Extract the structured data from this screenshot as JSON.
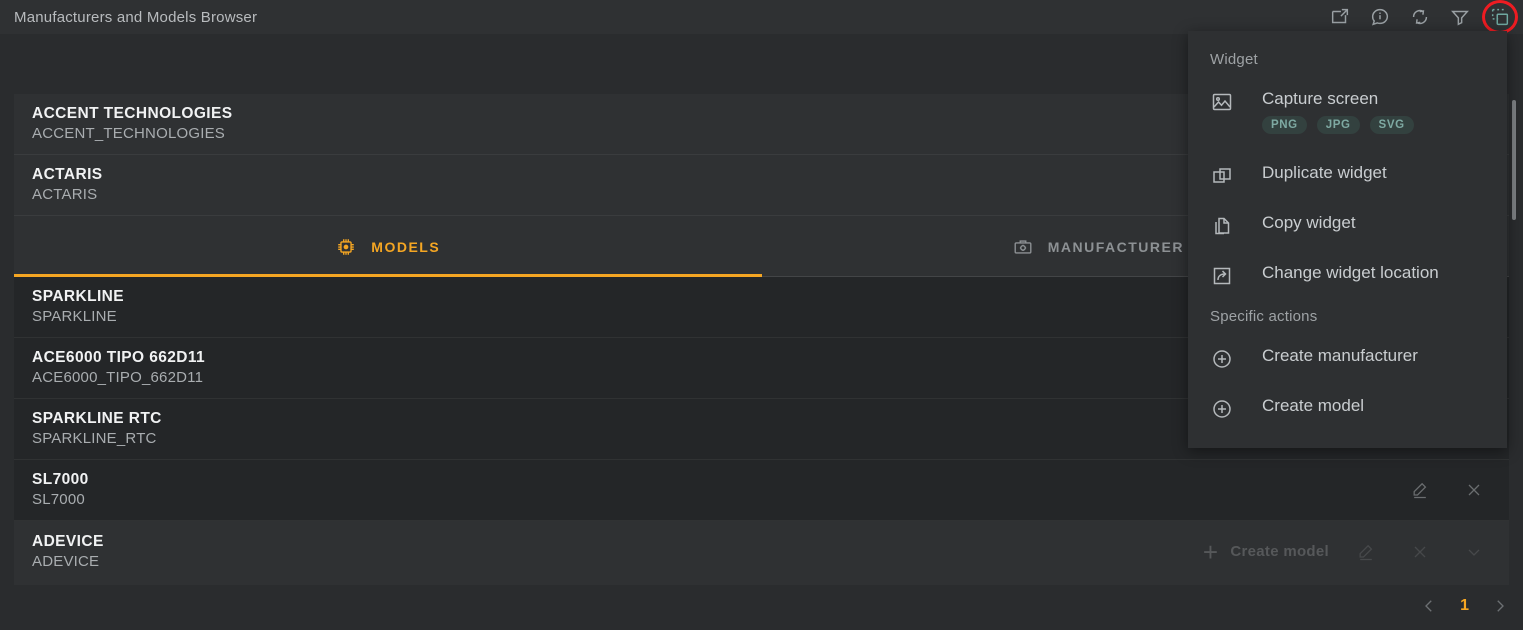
{
  "header": {
    "title": "Manufacturers and Models Browser",
    "icons": [
      {
        "name": "export-widget-icon",
        "label": "Export widget"
      },
      {
        "name": "info-icon",
        "label": "Information"
      },
      {
        "name": "refresh-icon",
        "label": "Refresh"
      },
      {
        "name": "filter-icon",
        "label": "Filter"
      },
      {
        "name": "widget-actions-icon",
        "label": "Widget actions"
      }
    ]
  },
  "list": {
    "manufacturers": [
      {
        "title": "ACCENT TECHNOLOGIES",
        "code": "ACCENT_TECHNOLOGIES",
        "create_label": "Create model",
        "hover": false
      },
      {
        "title": "ACTARIS",
        "code": "ACTARIS",
        "create_label": "Create model",
        "hover": true
      }
    ],
    "tabs": [
      {
        "label": "MODELS",
        "icon": "chip-icon",
        "active": true
      },
      {
        "label": "MANUFACTURER DETAILS",
        "icon": "toolbox-icon",
        "active": false
      }
    ],
    "models": [
      {
        "title": "SPARKLINE",
        "code": "SPARKLINE"
      },
      {
        "title": "ACE6000 TIPO 662D11",
        "code": "ACE6000_TIPO_662D11"
      },
      {
        "title": "SPARKLINE RTC",
        "code": "SPARKLINE_RTC"
      },
      {
        "title": "SL7000",
        "code": "SL7000"
      }
    ],
    "last_manufacturer": {
      "title": "ADEVICE",
      "code": "ADEVICE",
      "create_label": "Create model"
    }
  },
  "pagination": {
    "prev": "chevron-left-icon",
    "page": "1",
    "next": "chevron-right-icon"
  },
  "menu": {
    "section_widget": "Widget",
    "section_specific": "Specific actions",
    "capture": {
      "label": "Capture screen",
      "formats": [
        "PNG",
        "JPG",
        "SVG"
      ]
    },
    "items": [
      {
        "label": "Duplicate widget",
        "icon": "duplicate-icon"
      },
      {
        "label": "Copy widget",
        "icon": "copy-icon"
      },
      {
        "label": "Change widget location",
        "icon": "move-icon"
      }
    ],
    "specific": [
      {
        "label": "Create manufacturer",
        "icon": "plus-circle-icon"
      },
      {
        "label": "Create model",
        "icon": "plus-circle-icon"
      }
    ]
  },
  "colors": {
    "accent": "#f5a623",
    "annotation": "#ee1c22",
    "chip": "#7ea9a2",
    "widget_icon_active": "#6fa8a0"
  }
}
